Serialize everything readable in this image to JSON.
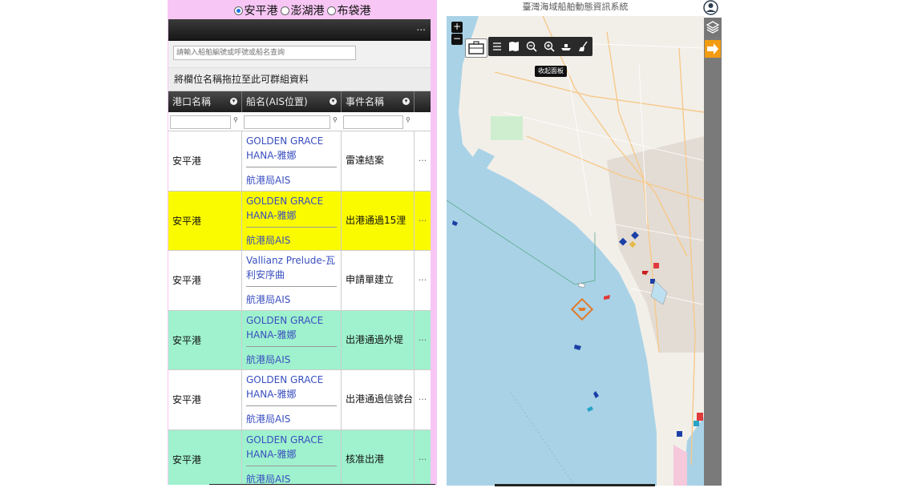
{
  "ports": {
    "options": [
      "安平港",
      "澎湖港",
      "布袋港"
    ],
    "selected": "安平港"
  },
  "toolbar": {
    "menu_label": "..."
  },
  "search": {
    "placeholder": "請輸入船舶編號或呼號或船名查詢"
  },
  "group_hint": "將欄位名稱拖拉至此可群組資料",
  "columns": [
    "港口名稱",
    "船名(AIS位置)",
    "事件名稱"
  ],
  "rows": [
    {
      "port": "安平港",
      "ship": "GOLDEN GRACE HANA-雅娜",
      "source": "航港局AIS",
      "event": "雷達結案",
      "style": "white"
    },
    {
      "port": "安平港",
      "ship": "GOLDEN GRACE HANA-雅娜",
      "source": "航港局AIS",
      "event": "出港通過15浬",
      "style": "yellow"
    },
    {
      "port": "安平港",
      "ship": "Vallianz Prelude-瓦利安序曲",
      "source": "航港局AIS",
      "event": "申請單建立",
      "style": "white"
    },
    {
      "port": "安平港",
      "ship": "GOLDEN GRACE HANA-雅娜",
      "source": "航港局AIS",
      "event": "出港通過外堤",
      "style": "green"
    },
    {
      "port": "安平港",
      "ship": "GOLDEN GRACE HANA-雅娜",
      "source": "航港局AIS",
      "event": "出港通過信號台",
      "style": "white"
    },
    {
      "port": "安平港",
      "ship": "GOLDEN GRACE HANA-雅娜",
      "source": "航港局AIS",
      "event": "核准出港",
      "style": "green"
    }
  ],
  "row_menu": "···",
  "map": {
    "title": "臺灣海域船舶動態資訊系統",
    "zoom_in": "+",
    "zoom_out": "−",
    "tooltip": "收起面板",
    "tools": [
      "list-icon",
      "map-book-icon",
      "zoom-out-icon",
      "zoom-in-icon",
      "ship-icon",
      "broom-icon"
    ],
    "colors": {
      "sea": "#a9d2e6",
      "land": "#f2efe9",
      "accent": "#f39c12"
    }
  }
}
